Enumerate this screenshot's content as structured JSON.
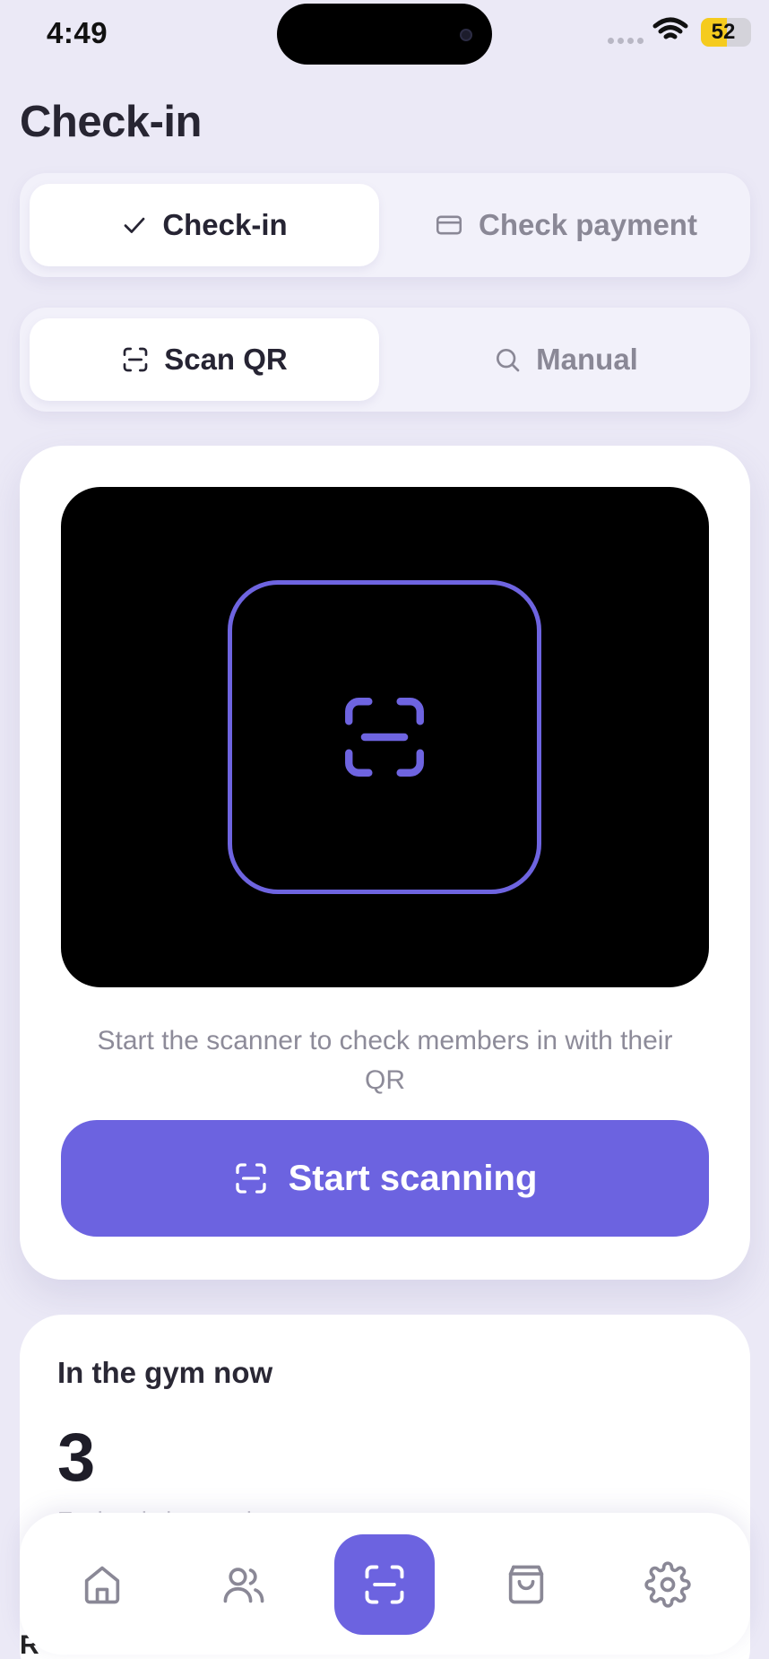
{
  "status_bar": {
    "time": "4:49",
    "battery": "52",
    "battery_level": 0.52
  },
  "page": {
    "title": "Check-in"
  },
  "mode_tabs": [
    {
      "label": "Check-in",
      "icon": "check-icon",
      "active": true
    },
    {
      "label": "Check payment",
      "icon": "card-icon",
      "active": false
    }
  ],
  "method_tabs": [
    {
      "label": "Scan QR",
      "icon": "scan-icon",
      "active": true
    },
    {
      "label": "Manual",
      "icon": "search-icon",
      "active": false
    }
  ],
  "scanner": {
    "hint": "Start the scanner to check members in with their QR",
    "start_button": "Start scanning",
    "accent_color": "#6c63e0"
  },
  "gym_card": {
    "title": "In the gym now",
    "count": "3",
    "subtitle": "Each sale is complete"
  },
  "bottom_nav": [
    {
      "name": "home",
      "icon": "home-icon",
      "active": false
    },
    {
      "name": "members",
      "icon": "users-icon",
      "active": false
    },
    {
      "name": "check-in",
      "icon": "scan-icon",
      "active": true
    },
    {
      "name": "shop",
      "icon": "shopping-bag-icon",
      "active": false
    },
    {
      "name": "settings",
      "icon": "gear-icon",
      "active": false
    }
  ],
  "peek_text": "R"
}
